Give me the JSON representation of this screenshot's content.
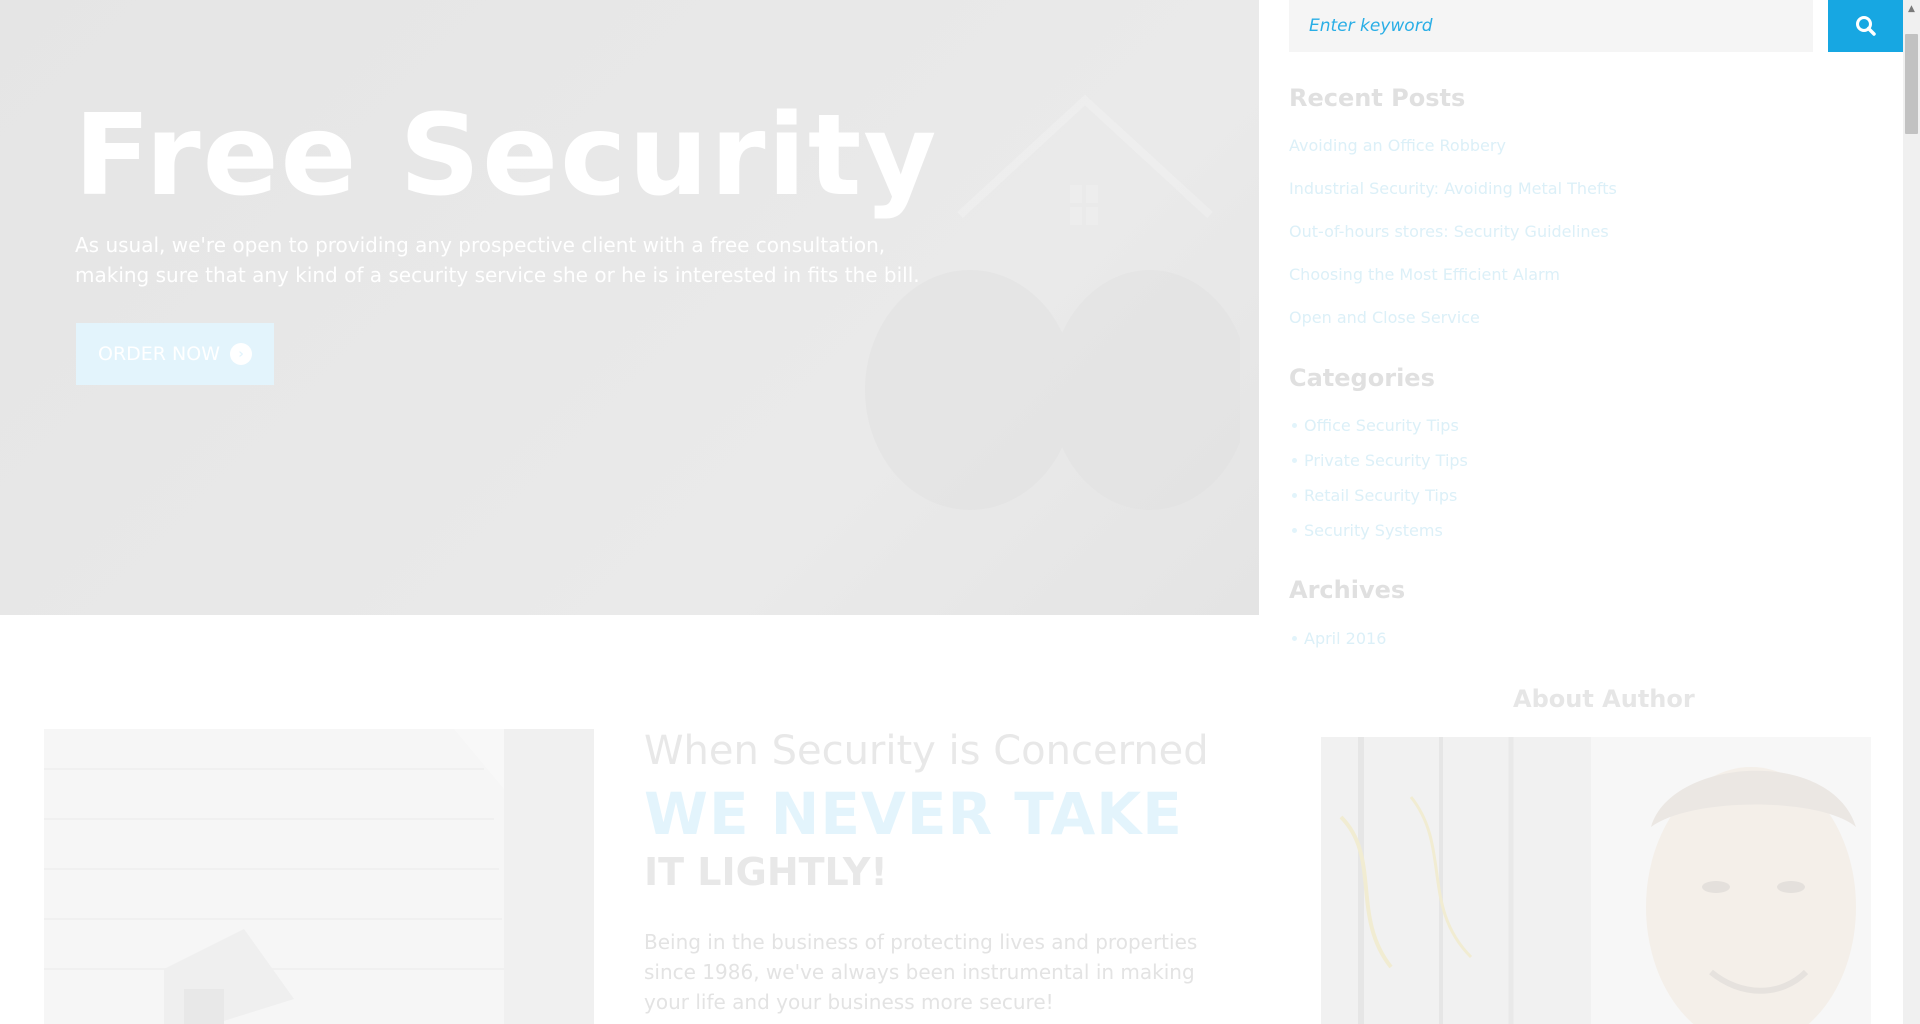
{
  "hero": {
    "title": "Free Security",
    "text": "As usual, we're open to providing any prospective client with a free consultation, making sure that any kind of a security service she or he is interested in fits the bill.",
    "button_label": "ORDER NOW"
  },
  "search": {
    "placeholder": "Enter keyword",
    "button_icon": "search-icon"
  },
  "sidebar": {
    "recent_posts_title": "Recent Posts",
    "recent_posts": [
      "Avoiding an Office Robbery",
      "Industrial Security: Avoiding Metal Thefts",
      "Out-of-hours stores: Security Guidelines",
      "Choosing the Most Efficient Alarm",
      "Open and Close Service"
    ],
    "categories_title": "Categories",
    "categories": [
      "Office Security Tips",
      "Private Security Tips",
      "Retail Security Tips",
      "Security Systems"
    ],
    "archives_title": "Archives",
    "archives": [
      "April 2016"
    ],
    "about_title": "About Author"
  },
  "concern": {
    "subtitle": "When Security is Concerned",
    "headline": "WE NEVER TAKE",
    "tail": "IT LIGHTLY!",
    "text": "Being in the business of protecting lives and properties since 1986, we've always been instrumental in making your life and your business more secure!"
  },
  "colors": {
    "accent": "#17a7e2",
    "link": "#29aee6"
  }
}
